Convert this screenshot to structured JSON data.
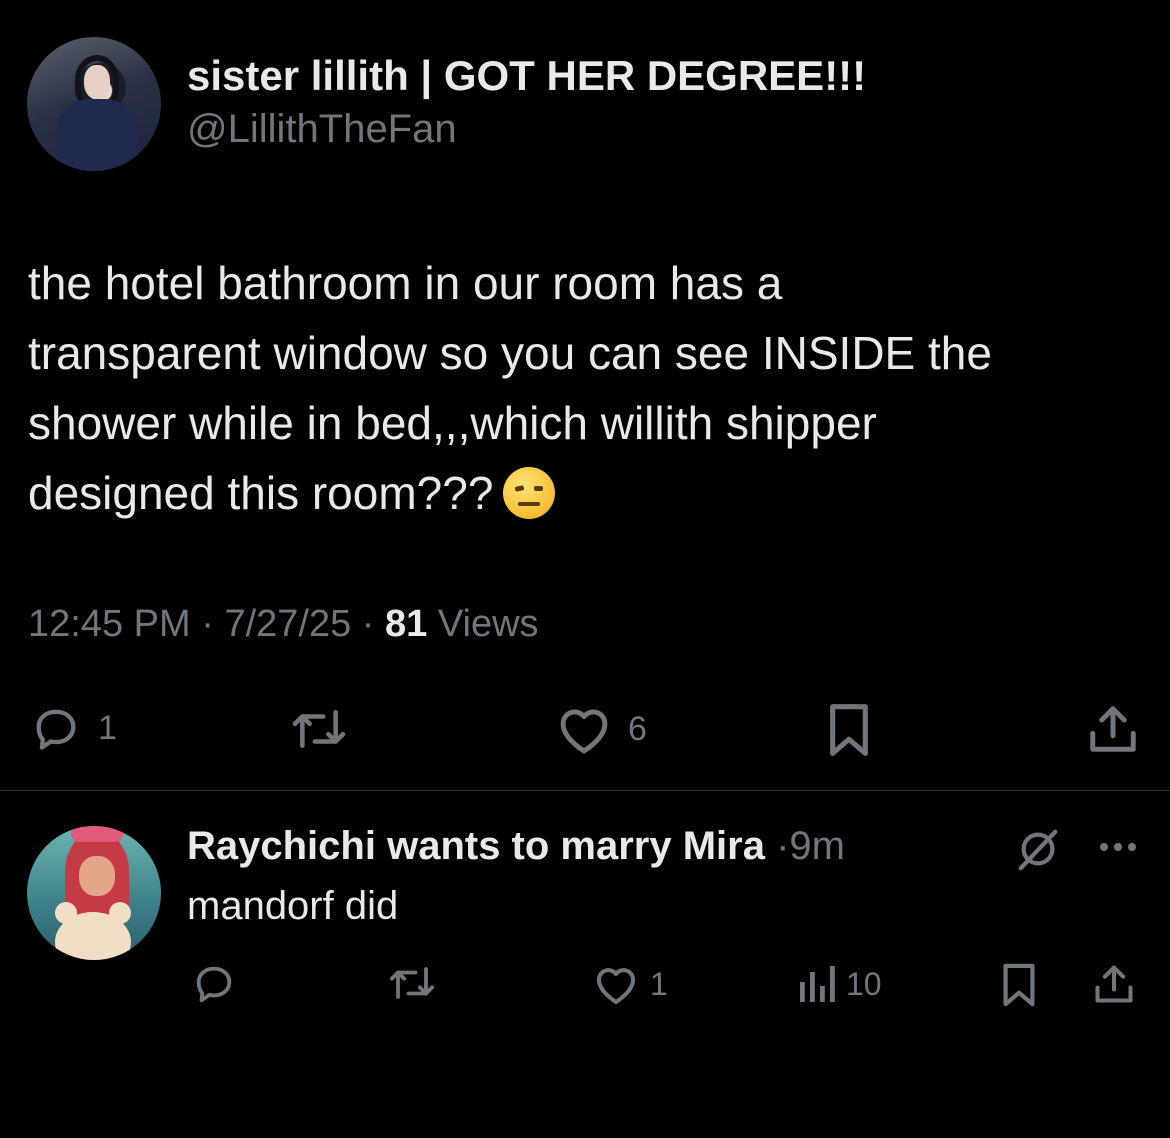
{
  "post": {
    "display_name": "sister lillith | GOT HER DEGREE!!!",
    "handle": "@LillithTheFan",
    "text_line1": "the hotel bathroom in our room has a",
    "text_line2": "transparent window so you can see INSIDE the",
    "text_line3": "shower while in bed,,,which willith shipper",
    "text_line4": "designed this room???",
    "emoji": "raised-eyebrow-emoji",
    "time": "12:45 PM",
    "date": "7/27/25",
    "views_count": "81",
    "views_label": "Views",
    "separator": "·",
    "reply_count": "1",
    "like_count": "6"
  },
  "reply": {
    "display_name": "Raychichi wants to marry Mira",
    "separator": "·",
    "time": "9m",
    "text": "mandorf did",
    "like_count": "1",
    "views_count": "10"
  },
  "colors": {
    "background": "#000000",
    "text_primary": "#e7e9ea",
    "text_secondary": "#71767b",
    "divider": "#2f3336"
  },
  "icons": [
    "reply-icon",
    "repost-icon",
    "like-icon",
    "bookmark-icon",
    "share-icon",
    "views-icon",
    "grok-icon",
    "more-icon"
  ]
}
